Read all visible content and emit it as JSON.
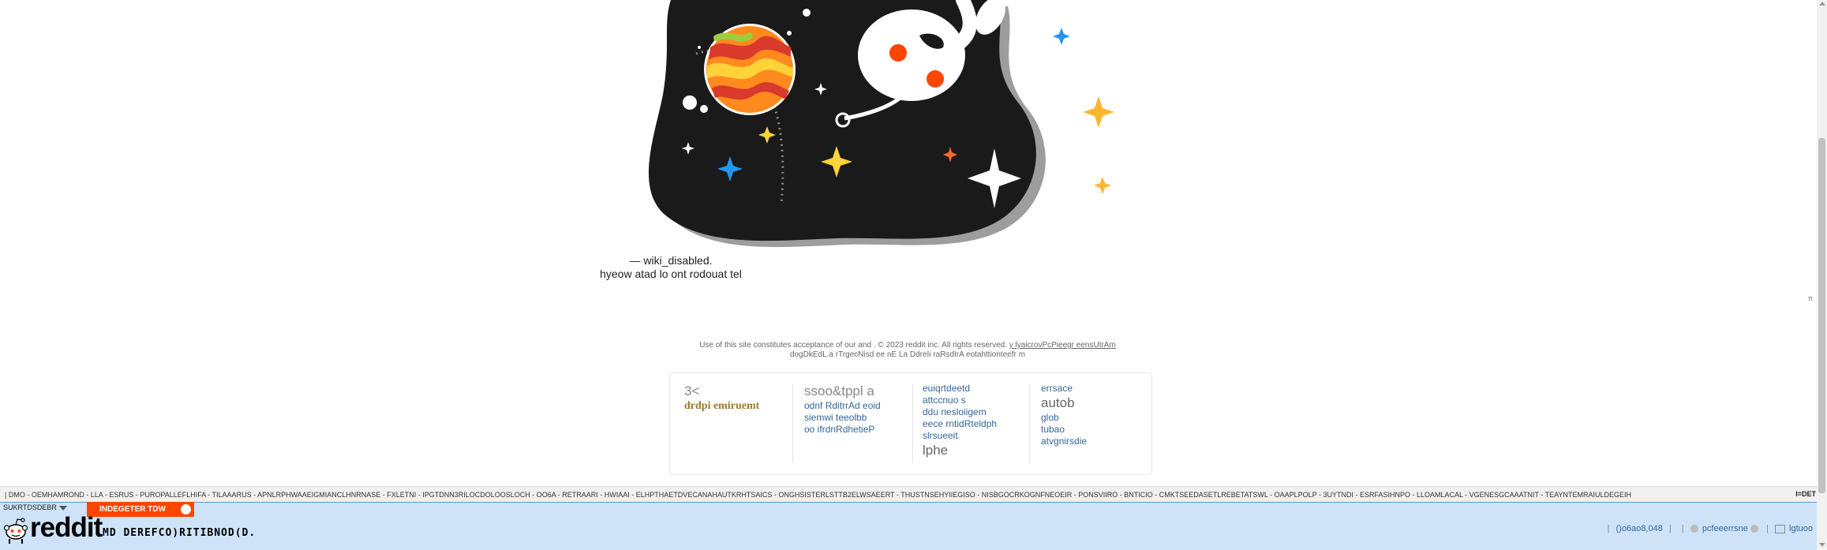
{
  "error": {
    "title": "— wiki_disabled.",
    "subtitle": "hyeow atad lo ont rodouat tel"
  },
  "legal": {
    "line1": "Use of this site constitutes acceptance of our and . © 2023 reddit inc. All rights reserved.",
    "line1_link": "y lyaicrovPcPieegr eensUtrAm",
    "line2": "dogDkEdL.a rTrgecNisd ee nE La DdreIi raRsdIrA eotahttionteefr m"
  },
  "footer": {
    "col1": {
      "heading": "3<",
      "link": "drdpi emiruemt"
    },
    "col2": {
      "heading": "ssoo&tppl a",
      "links": [
        "odnf RditrrAd eoid",
        "siemwi teeolbb",
        "oo ifrdnRdhetieP"
      ]
    },
    "col3": {
      "links": [
        "euiqrtdeetd",
        "attccnuo s",
        "ddu nesloiigem",
        "eece rntidRteldph",
        "slrsueeit"
      ],
      "heading": "lphe"
    },
    "col4": {
      "link_top": "errsace",
      "heading": "autob",
      "links": [
        "glob",
        "tubao",
        "atvgnirsdie"
      ]
    }
  },
  "ticker": {
    "items": "| DMO - OEMHAMROND - LLA - ESRUS - PUROPALLEFLHIFA - TILAAARUS - APNLRPHWAAEIGMIANCLHNRNASE - FXLETNI - IPGTDNN3RILOCDOLOOSLOCH - OO6A - RETRAARI - HWIAAI - ELHPTHAETDVECANAHAUTKRHTSAICS - ONGHSISTERLSTTB2ELWSAEERT - THUSTNSEHYIIEGISO - NISBGOCRKOGNFNEOEIR - PONSVIIRO - BNTICIO - CMKTSEEDASETLREBETATSWL - OAAPLPOLP - 3UYTNDI - ESRFASIHNPO - LLOAMLACAL - VGENESGCAAATNIT - TEAYNTEMRAIULDEGEIH",
    "right": "I=DET"
  },
  "header": {
    "sr_dropdown": "SUKRTDSDEBR",
    "orange_tab": "INDEGETER TDW",
    "logo_text": "reddit",
    "page_name": "MD DEREFCO)RITIBNOD(D.",
    "user_karma": "()o6ao8,048",
    "user_name": "pcfeeerrsne",
    "logout": "lgtuoo",
    "sep": "|"
  },
  "side_marker": "π",
  "colors": {
    "header_bg": "#cee3f8",
    "orange": "#ff4500",
    "link": "#336699",
    "gold": "#9a7b2d"
  }
}
